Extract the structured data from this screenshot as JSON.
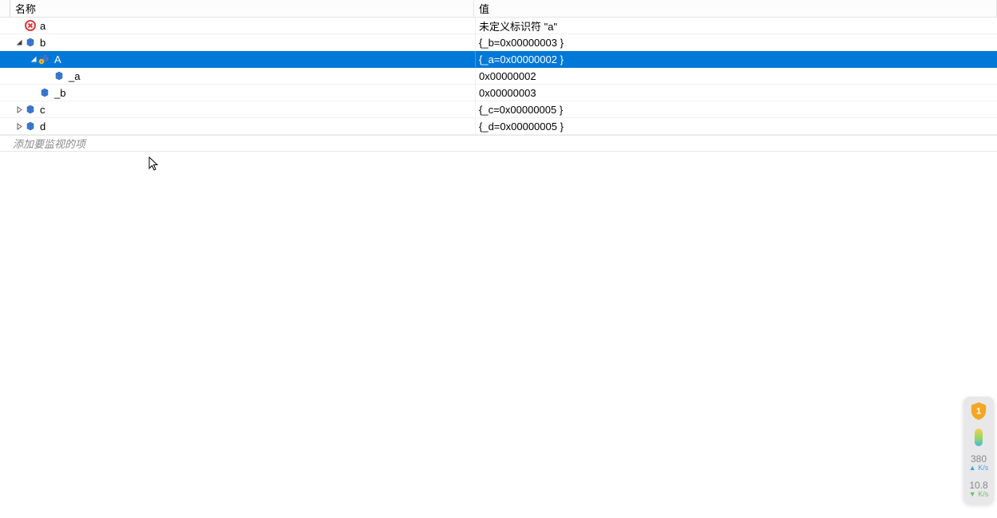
{
  "headers": {
    "name": "名称",
    "value": "值"
  },
  "rows": [
    {
      "id": "a",
      "depth": 0,
      "exp": "none",
      "icon": "error",
      "name": "a",
      "value": "未定义标识符 \"a\"",
      "sel": false
    },
    {
      "id": "b",
      "depth": 0,
      "exp": "open",
      "icon": "cube",
      "name": "b",
      "value": "{_b=0x00000003 }",
      "sel": false
    },
    {
      "id": "bA",
      "depth": 1,
      "exp": "open",
      "icon": "cubey",
      "name": "A",
      "value": "{_a=0x00000002 }",
      "sel": true
    },
    {
      "id": "ba",
      "depth": 2,
      "exp": "none",
      "icon": "cube",
      "name": "_a",
      "value": "0x00000002",
      "sel": false
    },
    {
      "id": "bb",
      "depth": 1,
      "exp": "none",
      "icon": "cube",
      "name": "_b",
      "value": "0x00000003",
      "sel": false
    },
    {
      "id": "c",
      "depth": 0,
      "exp": "closed",
      "icon": "cube",
      "name": "c",
      "value": "{_c=0x00000005 }",
      "sel": false
    },
    {
      "id": "d",
      "depth": 0,
      "exp": "closed",
      "icon": "cube",
      "name": "d",
      "value": "{_d=0x00000005 }",
      "sel": false
    }
  ],
  "addPlaceholder": "添加要监视的项",
  "widget": {
    "up": {
      "value": "380",
      "unit": "K/s"
    },
    "down": {
      "value": "10.8",
      "unit": "K/s"
    }
  }
}
